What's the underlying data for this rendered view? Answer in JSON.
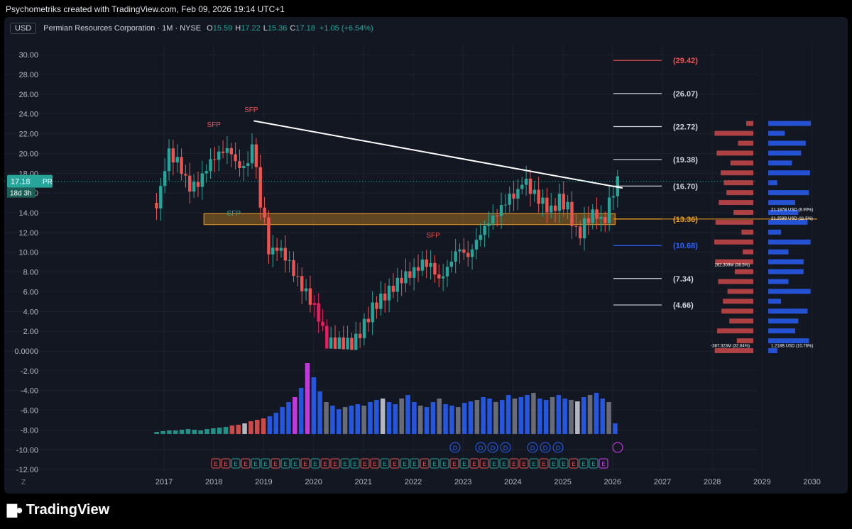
{
  "header": {
    "credit": "Psychometriks created with TradingView.com, Feb 09, 2026 19:14 UTC+1"
  },
  "legend": {
    "currency": "USD",
    "symbol": "Permian Resources Corporation · 1M · NYSE",
    "o_label": "O",
    "o_value": "15.59",
    "h_label": "H",
    "h_value": "17.22",
    "l_label": "L",
    "l_value": "15.36",
    "c_label": "C",
    "c_value": "17.18",
    "change": "+1.05 (+6.54%)"
  },
  "price_tag": {
    "value": "17.18",
    "ticker": "PR",
    "countdown": "18d 3h"
  },
  "bottom": {
    "brand": "TradingView",
    "z_button": "Z"
  },
  "colors": {
    "up": "#26a69a",
    "down": "#ef5350",
    "spike": "#e91e63",
    "zone": "#f0a020",
    "vol_blue": "#2962ff",
    "vol_gray": "#787b86",
    "bg": "#131722"
  },
  "chart_data": {
    "type": "candlestick",
    "y_axis": {
      "ticks": [
        "30.00",
        "28.00",
        "26.00",
        "24.00",
        "22.00",
        "20.00",
        "18.00",
        "16.00",
        "14.00",
        "12.00",
        "10.00",
        "8.00",
        "6.00",
        "4.00",
        "2.00",
        "0.0000",
        "-2.00",
        "-4.00",
        "-6.00",
        "-8.00",
        "-10.00",
        "-12.00"
      ],
      "range": [
        -12,
        31
      ]
    },
    "x_axis": {
      "ticks": [
        "2017",
        "2018",
        "2019",
        "2020",
        "2021",
        "2022",
        "2023",
        "2024",
        "2025",
        "2026",
        "2027",
        "2028",
        "2029",
        "2030"
      ]
    },
    "price_path": [
      [
        2016.9,
        15.0
      ],
      [
        2017.0,
        18.5
      ],
      [
        2017.1,
        20.0
      ],
      [
        2017.3,
        19.0
      ],
      [
        2017.5,
        16.5
      ],
      [
        2017.7,
        17.0
      ],
      [
        2017.9,
        19.0
      ],
      [
        2018.1,
        20.0
      ],
      [
        2018.3,
        20.5
      ],
      [
        2018.5,
        18.5
      ],
      [
        2018.7,
        19.0
      ],
      [
        2018.8,
        22.0
      ],
      [
        2018.9,
        15.0
      ],
      [
        2019.0,
        14.0
      ],
      [
        2019.1,
        10.0
      ],
      [
        2019.3,
        10.5
      ],
      [
        2019.5,
        9.0
      ],
      [
        2019.7,
        7.0
      ],
      [
        2019.9,
        5.5
      ],
      [
        2020.0,
        4.5
      ],
      [
        2020.1,
        3.5
      ],
      [
        2020.25,
        0.8
      ],
      [
        2020.5,
        0.8
      ],
      [
        2020.8,
        0.7
      ],
      [
        2021.0,
        2.5
      ],
      [
        2021.2,
        4.5
      ],
      [
        2021.4,
        5.5
      ],
      [
        2021.6,
        6.5
      ],
      [
        2021.8,
        7.5
      ],
      [
        2022.0,
        8.0
      ],
      [
        2022.2,
        9.0
      ],
      [
        2022.4,
        8.5
      ],
      [
        2022.5,
        7.0
      ],
      [
        2022.7,
        8.5
      ],
      [
        2022.9,
        10.5
      ],
      [
        2023.1,
        9.5
      ],
      [
        2023.3,
        11.5
      ],
      [
        2023.5,
        13.0
      ],
      [
        2023.7,
        14.0
      ],
      [
        2023.9,
        15.5
      ],
      [
        2024.1,
        16.0
      ],
      [
        2024.2,
        17.5
      ],
      [
        2024.4,
        16.0
      ],
      [
        2024.6,
        15.0
      ],
      [
        2024.8,
        14.0
      ],
      [
        2024.9,
        15.5
      ],
      [
        2025.1,
        14.5
      ],
      [
        2025.3,
        11.5
      ],
      [
        2025.5,
        13.5
      ],
      [
        2025.7,
        14.0
      ],
      [
        2025.8,
        12.5
      ],
      [
        2025.9,
        14.5
      ],
      [
        2026.0,
        16.0
      ],
      [
        2026.1,
        17.18
      ]
    ],
    "volume_heights": [
      0.03,
      0.04,
      0.05,
      0.05,
      0.06,
      0.07,
      0.06,
      0.05,
      0.07,
      0.08,
      0.09,
      0.1,
      0.12,
      0.13,
      0.15,
      0.18,
      0.2,
      0.22,
      0.25,
      0.3,
      0.38,
      0.45,
      0.52,
      0.65,
      1.0,
      0.8,
      0.6,
      0.45,
      0.4,
      0.35,
      0.38,
      0.4,
      0.42,
      0.4,
      0.45,
      0.48,
      0.5,
      0.45,
      0.42,
      0.5,
      0.55,
      0.45,
      0.4,
      0.38,
      0.45,
      0.5,
      0.42,
      0.4,
      0.38,
      0.44,
      0.46,
      0.48,
      0.52,
      0.5,
      0.45,
      0.48,
      0.55,
      0.5,
      0.52,
      0.55,
      0.58,
      0.5,
      0.48,
      0.52,
      0.55,
      0.5,
      0.48,
      0.46,
      0.52,
      0.55,
      0.58,
      0.5,
      0.45,
      0.15
    ],
    "annotations": [
      "SFP",
      "SFP",
      "SFP",
      "SFP"
    ],
    "trendline": {
      "from": [
        2018.8,
        23.3
      ],
      "to": [
        2026.2,
        16.5
      ]
    },
    "zone": {
      "from": 12.8,
      "to": 13.9,
      "start": 2017.8
    },
    "fib_levels": [
      {
        "label": "(29.42)",
        "value": 29.42,
        "color": "#ef5350"
      },
      {
        "label": "(26.07)",
        "value": 26.07,
        "color": "#d1d4dc"
      },
      {
        "label": "(22.72)",
        "value": 22.72,
        "color": "#d1d4dc"
      },
      {
        "label": "(19.38)",
        "value": 19.38,
        "color": "#d1d4dc"
      },
      {
        "label": "(16.70)",
        "value": 16.7,
        "color": "#d1d4dc"
      },
      {
        "label": "(13.36)",
        "value": 13.36,
        "color": "#f0a020"
      },
      {
        "label": "(10.68)",
        "value": 10.68,
        "color": "#2962ff"
      },
      {
        "label": "(7.34)",
        "value": 7.34,
        "color": "#d1d4dc"
      },
      {
        "label": "(4.66)",
        "value": 4.66,
        "color": "#d1d4dc"
      }
    ],
    "profile_left_labels": [
      "262.309M (38.5%)",
      "-387.323M (32.84%)"
    ],
    "profile_right_labels": [
      "21.187B USD (8.90%)",
      "21.258B USD (11.5%)",
      "1.218B USD (10.76%)"
    ],
    "events_dividends": [
      "D",
      "D",
      "D",
      "D",
      "D",
      "D",
      "D",
      "D"
    ],
    "events_earnings": [
      "E",
      "E",
      "E",
      "E",
      "E",
      "E",
      "E",
      "E",
      "E",
      "E",
      "E",
      "E",
      "E",
      "E",
      "E",
      "E",
      "E",
      "E",
      "E",
      "E",
      "E",
      "E",
      "E",
      "E",
      "E",
      "E",
      "E",
      "E",
      "E",
      "E",
      "E",
      "E",
      "E",
      "E",
      "E",
      "E",
      "E",
      "E",
      "E",
      "E",
      "E"
    ]
  }
}
